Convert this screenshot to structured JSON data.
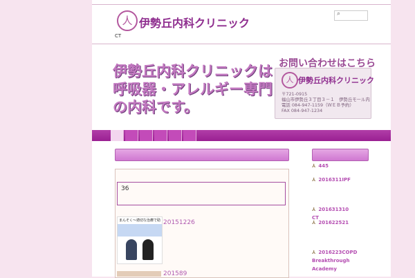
{
  "header": {
    "logo_text": "伊勢丘内科クリニック",
    "search_placeholder": "",
    "ct": "CT"
  },
  "hero": {
    "line1": "伊勢丘内科クリニックは",
    "line2": "呼吸器・アレルギー専門",
    "line3": "の内科です。"
  },
  "contact": {
    "title": "お問い合わせはこちら",
    "clinic": "伊勢丘内科クリニック",
    "line1": "〒721-0915",
    "line2": "福山市伊勢丘３丁目３－１　伊勢丘モール内",
    "line3": "電話 084-947-1159（ＷＥＢ予約）",
    "line4": "FAX 084-947-1234"
  },
  "content": {
    "count": "36",
    "news1": "20151226",
    "news2": "201589",
    "thumb_caption": "まんそく～適切な治療で助けます"
  },
  "sidebar": {
    "items": [
      "445",
      "2016311IPF",
      "201631310\nCT",
      "201622521",
      "2016223COPD\nBreakthrough\nAcademy"
    ]
  },
  "colors": {
    "accent": "#b13ea8",
    "link": "#b05ab0"
  }
}
